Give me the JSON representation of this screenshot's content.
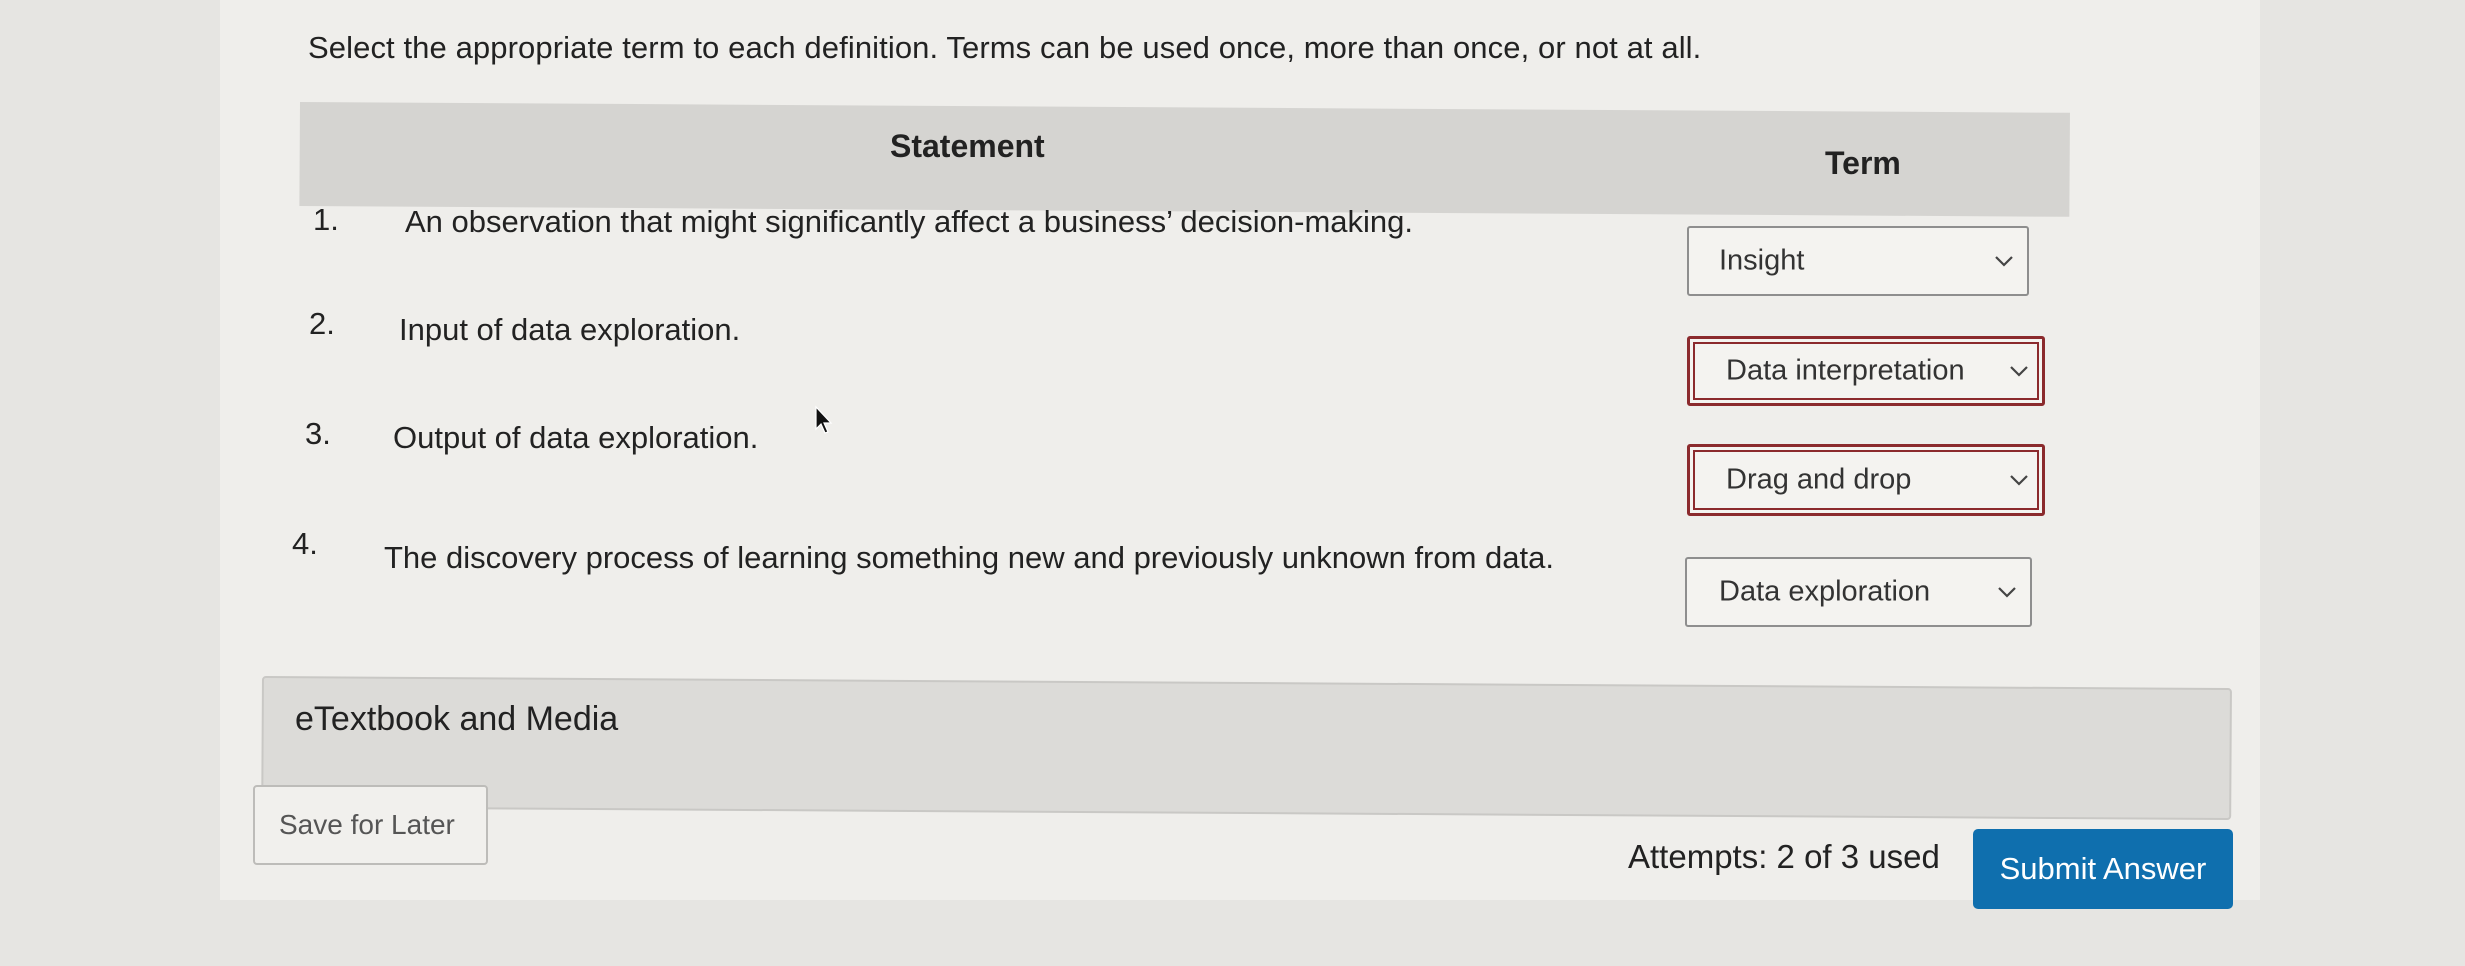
{
  "instructions": "Select the appropriate term to each definition. Terms can be used once, more than once, or not at all.",
  "table": {
    "header_statement": "Statement",
    "header_term": "Term",
    "rows": [
      {
        "num": "1.",
        "statement": "An observation that might significantly affect a business’ decision-making.",
        "term": "Insight",
        "state": "normal"
      },
      {
        "num": "2.",
        "statement": "Input of data exploration.",
        "term": "Data interpretation",
        "state": "error"
      },
      {
        "num": "3.",
        "statement": "Output of data exploration.",
        "term": "Drag and drop",
        "state": "error"
      },
      {
        "num": "4.",
        "statement": "The discovery process of learning something new and previously unknown from data.",
        "term": "Data exploration",
        "state": "normal"
      }
    ]
  },
  "media": {
    "label": "eTextbook and Media"
  },
  "footer": {
    "save_label": "Save for Later",
    "attempts": "Attempts: 2 of 3 used",
    "submit_label": "Submit Answer"
  },
  "colors": {
    "error_border": "#8b2a2d",
    "submit_bg": "#0f6fae",
    "header_bg": "#d5d4d1"
  },
  "icons": {
    "dropdown": "chevron-down-icon",
    "cursor": "mouse-pointer-icon"
  }
}
